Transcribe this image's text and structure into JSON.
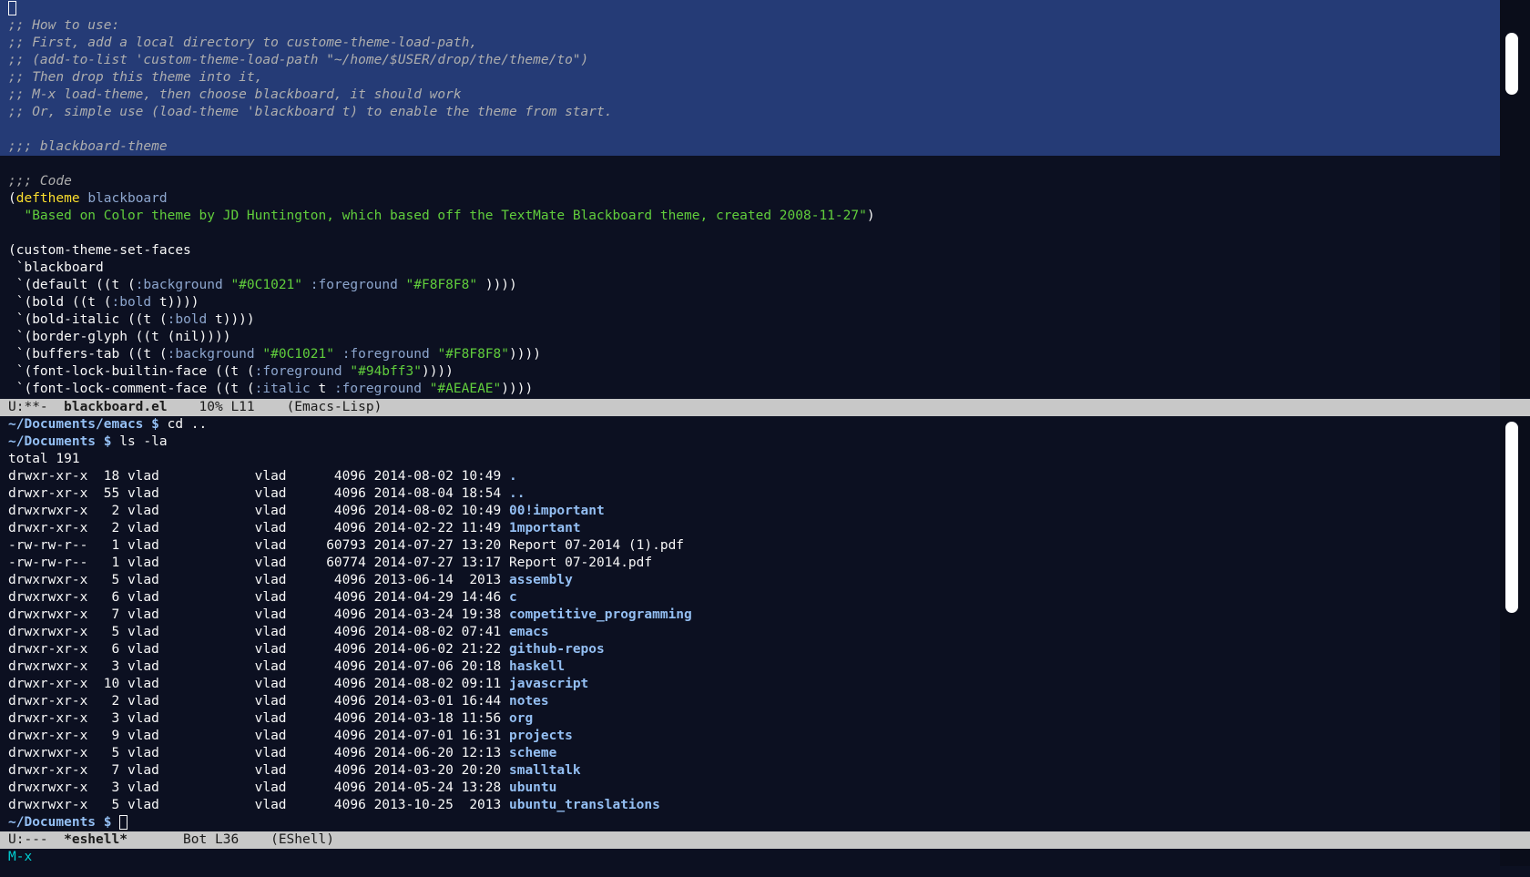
{
  "editor": {
    "comments": [
      ";; How to use:",
      ";; First, add a local directory to custome-theme-load-path,",
      ";; (add-to-list 'custom-theme-load-path \"~/home/$USER/drop/the/theme/to\")",
      ";; Then drop this theme into it,",
      ";; M-x load-theme, then choose blackboard, it should work",
      ";; Or, simple use (load-theme 'blackboard t) to enable the theme from start."
    ],
    "header_comment": ";;; blackboard-theme",
    "code_comment": ";;; Code",
    "deftheme_kw": "deftheme",
    "deftheme_name": "blackboard",
    "doc_string": "\"Based on Color theme by JD Huntington, which based off the TextMate Blackboard theme, created 2008-11-27\"",
    "set_faces": "(custom-theme-set-faces",
    "theme_sym": " `blackboard",
    "faces": [
      [
        {
          "t": " `(default ((t ("
        },
        {
          "t": ":background",
          "c": "key"
        },
        {
          "t": " "
        },
        {
          "t": "\"#0C1021\"",
          "c": "str"
        },
        {
          "t": " "
        },
        {
          "t": ":foreground",
          "c": "key"
        },
        {
          "t": " "
        },
        {
          "t": "\"#F8F8F8\"",
          "c": "str"
        },
        {
          "t": " ))))"
        }
      ],
      [
        {
          "t": " `(bold ((t ("
        },
        {
          "t": ":bold",
          "c": "key"
        },
        {
          "t": " t))))"
        }
      ],
      [
        {
          "t": " `(bold-italic ((t ("
        },
        {
          "t": ":bold",
          "c": "key"
        },
        {
          "t": " t))))"
        }
      ],
      [
        {
          "t": " `(border-glyph ((t (nil))))"
        }
      ],
      [
        {
          "t": " `(buffers-tab ((t ("
        },
        {
          "t": ":background",
          "c": "key"
        },
        {
          "t": " "
        },
        {
          "t": "\"#0C1021\"",
          "c": "str"
        },
        {
          "t": " "
        },
        {
          "t": ":foreground",
          "c": "key"
        },
        {
          "t": " "
        },
        {
          "t": "\"#F8F8F8\"",
          "c": "str"
        },
        {
          "t": "))))"
        }
      ],
      [
        {
          "t": " `(font-lock-builtin-face ((t ("
        },
        {
          "t": ":foreground",
          "c": "key"
        },
        {
          "t": " "
        },
        {
          "t": "\"#94bff3\"",
          "c": "str"
        },
        {
          "t": "))))"
        }
      ],
      [
        {
          "t": " `(font-lock-comment-face ((t ("
        },
        {
          "t": ":italic",
          "c": "key"
        },
        {
          "t": " t "
        },
        {
          "t": ":foreground",
          "c": "key"
        },
        {
          "t": " "
        },
        {
          "t": "\"#AEAEAE\"",
          "c": "str"
        },
        {
          "t": "))))"
        }
      ]
    ]
  },
  "mode_line_top": {
    "status": "U:**-  ",
    "buffer": "blackboard.el",
    "position": "    10% L11    ",
    "mode": "(Emacs-Lisp)"
  },
  "shell": {
    "history": [
      {
        "prompt": "~/Documents/emacs $",
        "cmd": " cd .."
      },
      {
        "prompt": "~/Documents $",
        "cmd": " ls -la"
      }
    ],
    "total": "total 191",
    "entries": [
      {
        "perm": "drwxr-xr-x",
        "links": "18",
        "user": "vlad",
        "group": "vlad",
        "size": "4096",
        "date": "2014-08-02 10:49",
        "name": ".",
        "dir": true
      },
      {
        "perm": "drwxr-xr-x",
        "links": "55",
        "user": "vlad",
        "group": "vlad",
        "size": "4096",
        "date": "2014-08-04 18:54",
        "name": "..",
        "dir": true
      },
      {
        "perm": "drwxrwxr-x",
        "links": "2",
        "user": "vlad",
        "group": "vlad",
        "size": "4096",
        "date": "2014-08-02 10:49",
        "name": "00!important",
        "dir": true
      },
      {
        "perm": "drwxr-xr-x",
        "links": "2",
        "user": "vlad",
        "group": "vlad",
        "size": "4096",
        "date": "2014-02-22 11:49",
        "name": "1mportant",
        "dir": true
      },
      {
        "perm": "-rw-rw-r--",
        "links": "1",
        "user": "vlad",
        "group": "vlad",
        "size": "60793",
        "date": "2014-07-27 13:20",
        "name": "Report 07-2014 (1).pdf",
        "dir": false
      },
      {
        "perm": "-rw-rw-r--",
        "links": "1",
        "user": "vlad",
        "group": "vlad",
        "size": "60774",
        "date": "2014-07-27 13:17",
        "name": "Report 07-2014.pdf",
        "dir": false
      },
      {
        "perm": "drwxrwxr-x",
        "links": "5",
        "user": "vlad",
        "group": "vlad",
        "size": "4096",
        "date": "2013-06-14  2013",
        "name": "assembly",
        "dir": true
      },
      {
        "perm": "drwxrwxr-x",
        "links": "6",
        "user": "vlad",
        "group": "vlad",
        "size": "4096",
        "date": "2014-04-29 14:46",
        "name": "c",
        "dir": true
      },
      {
        "perm": "drwxrwxr-x",
        "links": "7",
        "user": "vlad",
        "group": "vlad",
        "size": "4096",
        "date": "2014-03-24 19:38",
        "name": "competitive_programming",
        "dir": true
      },
      {
        "perm": "drwxrwxr-x",
        "links": "5",
        "user": "vlad",
        "group": "vlad",
        "size": "4096",
        "date": "2014-08-02 07:41",
        "name": "emacs",
        "dir": true
      },
      {
        "perm": "drwxr-xr-x",
        "links": "6",
        "user": "vlad",
        "group": "vlad",
        "size": "4096",
        "date": "2014-06-02 21:22",
        "name": "github-repos",
        "dir": true
      },
      {
        "perm": "drwxrwxr-x",
        "links": "3",
        "user": "vlad",
        "group": "vlad",
        "size": "4096",
        "date": "2014-07-06 20:18",
        "name": "haskell",
        "dir": true
      },
      {
        "perm": "drwxr-xr-x",
        "links": "10",
        "user": "vlad",
        "group": "vlad",
        "size": "4096",
        "date": "2014-08-02 09:11",
        "name": "javascript",
        "dir": true
      },
      {
        "perm": "drwxr-xr-x",
        "links": "2",
        "user": "vlad",
        "group": "vlad",
        "size": "4096",
        "date": "2014-03-01 16:44",
        "name": "notes",
        "dir": true
      },
      {
        "perm": "drwxr-xr-x",
        "links": "3",
        "user": "vlad",
        "group": "vlad",
        "size": "4096",
        "date": "2014-03-18 11:56",
        "name": "org",
        "dir": true
      },
      {
        "perm": "drwxr-xr-x",
        "links": "9",
        "user": "vlad",
        "group": "vlad",
        "size": "4096",
        "date": "2014-07-01 16:31",
        "name": "projects",
        "dir": true
      },
      {
        "perm": "drwxrwxr-x",
        "links": "5",
        "user": "vlad",
        "group": "vlad",
        "size": "4096",
        "date": "2014-06-20 12:13",
        "name": "scheme",
        "dir": true
      },
      {
        "perm": "drwxr-xr-x",
        "links": "7",
        "user": "vlad",
        "group": "vlad",
        "size": "4096",
        "date": "2014-03-20 20:20",
        "name": "smalltalk",
        "dir": true
      },
      {
        "perm": "drwxrwxr-x",
        "links": "3",
        "user": "vlad",
        "group": "vlad",
        "size": "4096",
        "date": "2014-05-24 13:28",
        "name": "ubuntu",
        "dir": true
      },
      {
        "perm": "drwxrwxr-x",
        "links": "5",
        "user": "vlad",
        "group": "vlad",
        "size": "4096",
        "date": "2013-10-25  2013",
        "name": "ubuntu_translations",
        "dir": true
      }
    ],
    "current_prompt": "~/Documents $"
  },
  "mode_line_bottom": {
    "status": "U:---  ",
    "buffer": "*eshell*",
    "position": "       Bot L36    ",
    "mode": "(EShell)"
  },
  "minibuffer": "M-x"
}
